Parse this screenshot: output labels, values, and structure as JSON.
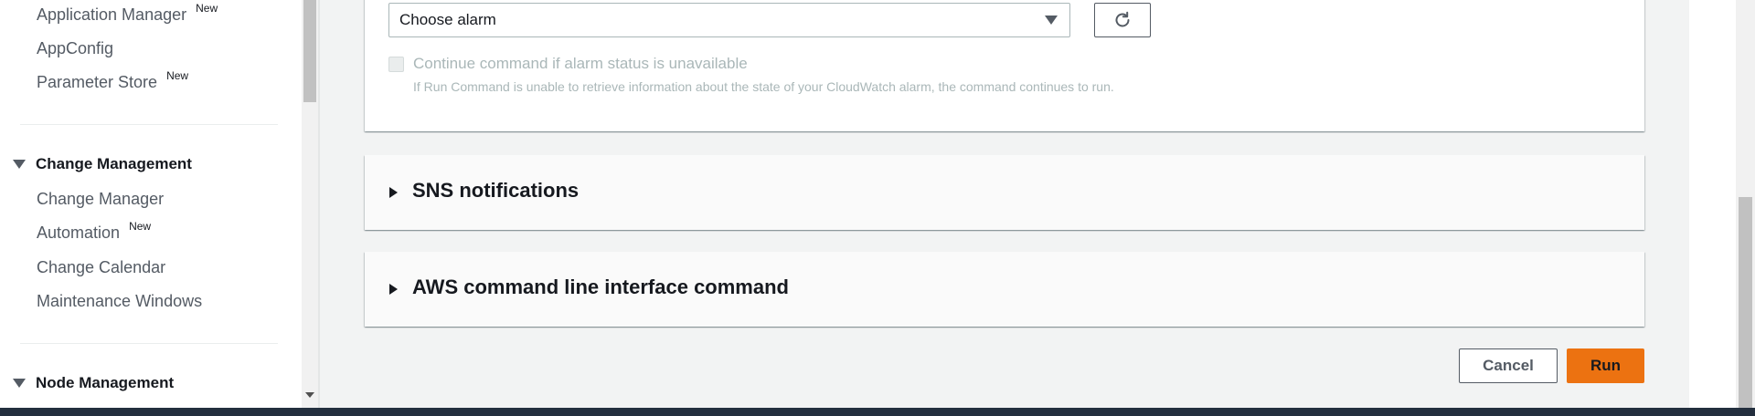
{
  "sidebar": {
    "top_links": [
      {
        "label": "Application Manager",
        "badge": "New"
      },
      {
        "label": "AppConfig",
        "badge": ""
      },
      {
        "label": "Parameter Store",
        "badge": "New"
      }
    ],
    "change_management": {
      "title": "Change Management",
      "items": [
        {
          "label": "Change Manager",
          "badge": ""
        },
        {
          "label": "Automation",
          "badge": "New"
        },
        {
          "label": "Change Calendar",
          "badge": ""
        },
        {
          "label": "Maintenance Windows",
          "badge": ""
        }
      ]
    },
    "node_management": {
      "title": "Node Management"
    }
  },
  "alarm": {
    "select_value": "Choose alarm",
    "checkbox_label": "Continue command if alarm status is unavailable",
    "checkbox_checked": false,
    "checkbox_description": "If Run Command is unable to retrieve information about the state of your CloudWatch alarm, the command continues to run."
  },
  "sections": {
    "sns": {
      "title": "SNS notifications"
    },
    "cli": {
      "title": "AWS command line interface command"
    }
  },
  "actions": {
    "cancel_label": "Cancel",
    "run_label": "Run"
  },
  "colors": {
    "primary_button": "#ec7211",
    "footer_bar": "#232f3e",
    "page_background": "#f2f3f3"
  },
  "icons": {
    "refresh": "refresh-icon",
    "expand": "caret-right-icon",
    "section": "caret-down-icon",
    "dropdown": "chevron-down-icon"
  }
}
